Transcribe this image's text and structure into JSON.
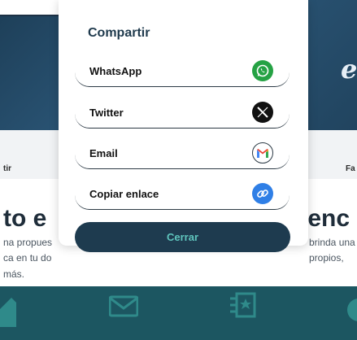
{
  "share_modal": {
    "title": "Compartir",
    "options": [
      {
        "label": "WhatsApp",
        "icon": "whatsapp-icon",
        "color": "#25a244"
      },
      {
        "label": "Twitter",
        "icon": "x-twitter-icon",
        "color": "#111111"
      },
      {
        "label": "Email",
        "icon": "gmail-icon",
        "color": "#ffffff"
      },
      {
        "label": "Copiar enlace",
        "icon": "link-icon",
        "color": "#2f7fe6"
      }
    ],
    "close_label": "Cerrar"
  },
  "background": {
    "hero_script": "e",
    "strip_left": "tir",
    "strip_right": "Fa",
    "heading_left": "to e",
    "heading_right": "genc",
    "paragraph_lines": [
      "na propues",
      "ca en tu do",
      "más."
    ],
    "paragraph_right_lines": [
      "brinda una",
      "propios,"
    ],
    "bottom_nav_icons": [
      "home-icon",
      "mail-icon",
      "star-list-icon",
      "phone-icon"
    ]
  },
  "colors": {
    "modal_button_bg": "#1e3b4f",
    "modal_button_text": "#5fc5bd",
    "hero_bg": "#2b5677",
    "bottom_nav_bg": "#1c5661"
  }
}
